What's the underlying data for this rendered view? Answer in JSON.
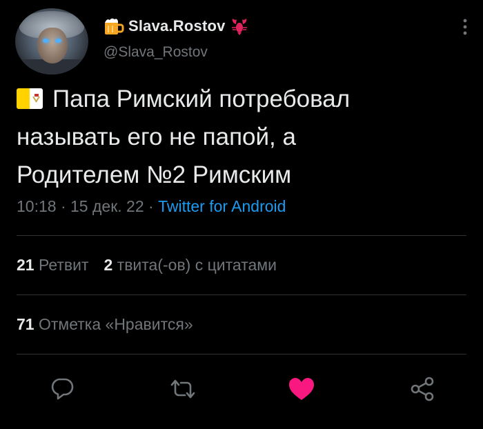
{
  "author": {
    "display_name": "Slava.Rostov",
    "handle": "@Slava_Rostov",
    "name_emoji_before": "beer-mug-icon",
    "name_emoji_after": "lobster-icon"
  },
  "tweet": {
    "flag_icon": "vatican-flag-icon",
    "lines": [
      "Папа Римский потребовал",
      "называть его не папой, а",
      "Родителем №2 Римским"
    ]
  },
  "meta": {
    "time": "10:18",
    "separator": " · ",
    "date": "15 дек. 22",
    "source": "Twitter for Android"
  },
  "stats": {
    "retweets_count": "21",
    "retweets_label": "Ретвит",
    "quotes_count": "2",
    "quotes_label": "твита(-ов) с цитатами",
    "likes_count": "71",
    "likes_label": "Отметка «Нравится»"
  },
  "actions": [
    "reply-icon",
    "retweet-icon",
    "like-icon",
    "share-icon"
  ],
  "colors": {
    "background": "#000000",
    "text": "#e7e9ea",
    "secondary": "#71767b",
    "link": "#1d9bf0",
    "like": "#f91880",
    "divider": "#2f3336"
  }
}
